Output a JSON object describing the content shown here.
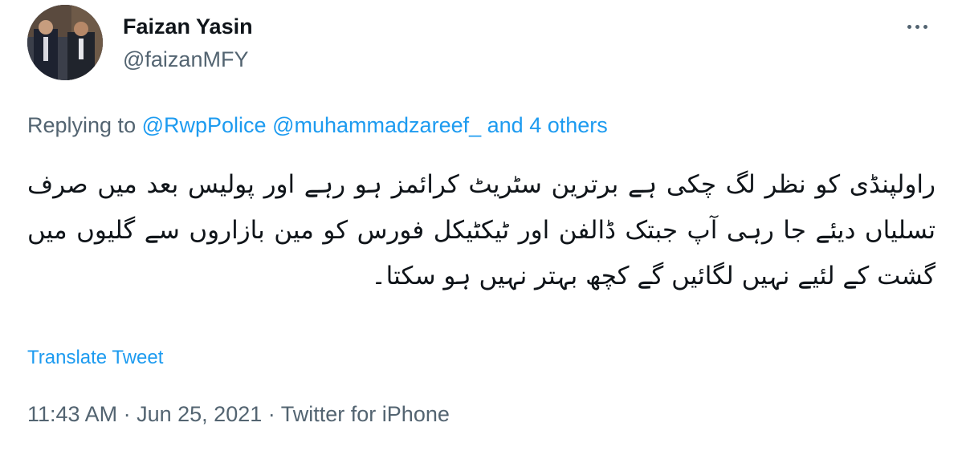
{
  "author": {
    "name": "Faizan Yasin",
    "handle": "@faizanMFY"
  },
  "menu": {
    "more_icon": "more-horizontal-icon"
  },
  "reply": {
    "prefix": "Replying to",
    "mentions": [
      "@RwpPolice",
      "@muhammadzareef_"
    ],
    "others": "and 4 others"
  },
  "tweet": {
    "text": "راولپنڈی کو نظر لگ چکی ہے برترین سٹریٹ کرائمز ہو رہے اور پولیس بعد میں صرف تسلیاں دیئے جا رہی آپ جبتک ڈالفن اور ٹیکٹیکل فورس کو مین بازاروں سے گلیوں میں گشت کے لئیے نہیں لگائیں گے کچھ بہتر نہیں ہو سکتا۔",
    "translate_label": "Translate Tweet"
  },
  "meta": {
    "time": "11:43 AM",
    "separator": "·",
    "date": "Jun 25, 2021",
    "source": "Twitter for iPhone"
  },
  "colors": {
    "link": "#1d9bf0",
    "secondary": "#536471",
    "primary": "#0f1419"
  }
}
